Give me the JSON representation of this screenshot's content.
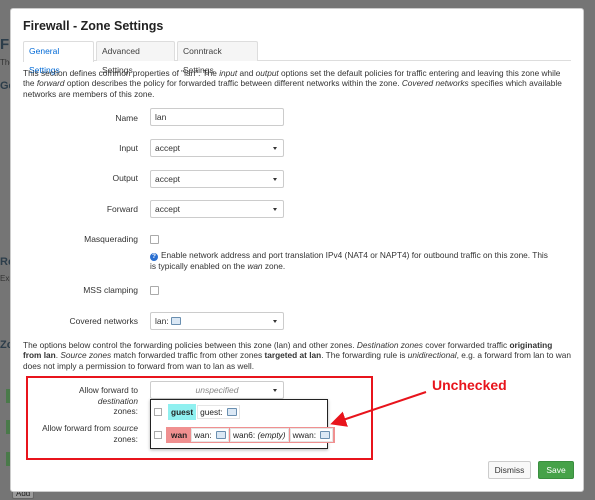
{
  "background": {
    "page_title_fragment": "Fi",
    "subtitle_fragment": "The",
    "heading_ge": "Ge",
    "heading_ro": "Ro",
    "text_exp": "Exp",
    "heading_zo": "Zo",
    "add_label": "Add"
  },
  "modal": {
    "title": "Firewall - Zone Settings",
    "tabs": [
      {
        "label": "General Settings",
        "active": true
      },
      {
        "label": "Advanced Settings",
        "active": false
      },
      {
        "label": "Conntrack Settings",
        "active": false
      }
    ],
    "intro": {
      "p1": "This section defines common properties of \"lan\". The ",
      "input_word": "input",
      "p2": " and ",
      "output_word": "output",
      "p3": " options set the default policies for traffic entering and leaving this zone while the ",
      "forward_word": "forward",
      "p4": " option describes the policy for forwarded traffic between different networks within the zone. ",
      "covered_word": "Covered networks",
      "p5": " specifies which available networks are members of this zone."
    },
    "fields": {
      "name": {
        "label": "Name",
        "value": "lan"
      },
      "input": {
        "label": "Input",
        "value": "accept"
      },
      "output": {
        "label": "Output",
        "value": "accept"
      },
      "forward": {
        "label": "Forward",
        "value": "accept"
      },
      "masquerading": {
        "label": "Masquerading",
        "checked": false,
        "hint_a": "Enable network address and port translation IPv4 (NAT4 or NAPT4) for outbound traffic on this zone. This is typically enabled on the ",
        "hint_wan": "wan",
        "hint_b": " zone."
      },
      "mss": {
        "label": "MSS clamping",
        "checked": false
      },
      "covered": {
        "label": "Covered networks",
        "value": "lan:"
      }
    },
    "forwarding_desc": {
      "a": "The options below control the forwarding policies between this zone (lan) and other zones. ",
      "dest_word": "Destination zones",
      "b": " cover forwarded traffic ",
      "orig_bold": "originating from lan",
      "c": ". ",
      "src_word": "Source zones",
      "d": " match forwarded traffic from other zones ",
      "target_bold": "targeted at lan",
      "e": ". The forwarding rule is ",
      "unidir_word": "unidirectional",
      "f": ", e.g. a forward from lan to wan does not imply a permission to forward from wan to lan as well."
    },
    "forward_dest": {
      "label_a": "Allow forward to ",
      "label_i": "destination",
      "label_b": " zones:",
      "placeholder": "unspecified"
    },
    "forward_src": {
      "label_a": "Allow forward from ",
      "label_i": "source",
      "label_b": " zones:"
    },
    "zones": [
      {
        "name": "guest",
        "color": "#90f0f0",
        "nets": [
          {
            "label": "guest:",
            "value": ""
          }
        ]
      },
      {
        "name": "wan",
        "color": "#f09090",
        "nets": [
          {
            "label": "wan:",
            "value": ""
          },
          {
            "label": "wan6:",
            "value": "(empty)"
          },
          {
            "label": "wwan:",
            "value": ""
          }
        ]
      }
    ],
    "annotation": "Unchecked",
    "buttons": {
      "dismiss": "Dismiss",
      "save": "Save"
    }
  },
  "colors": {
    "accent": "#0069d6",
    "save_green": "#46a249",
    "highlight_red": "#e8141c"
  }
}
